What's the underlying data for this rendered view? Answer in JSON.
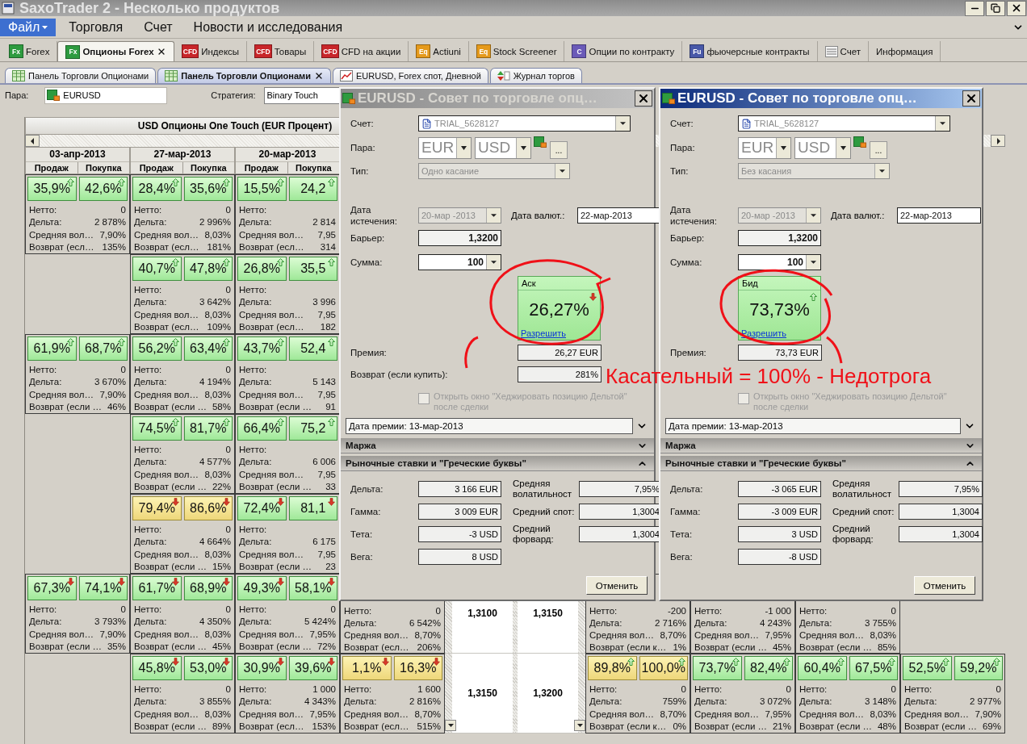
{
  "window": {
    "title": "SaxoTrader 2 - Несколько продуктов"
  },
  "menu": [
    {
      "label": "Файл",
      "selected": true
    },
    {
      "label": "Торговля",
      "selected": false
    },
    {
      "label": "Счет",
      "selected": false
    },
    {
      "label": "Новости и исследования",
      "selected": false
    }
  ],
  "product_tabs": [
    {
      "label": "Forex",
      "kind": "badge",
      "badge": "Fx",
      "color": "#2e9b3f",
      "selected": false
    },
    {
      "label": "Опционы Forex",
      "kind": "badge",
      "badge": "Fx",
      "color": "#2e9b3f",
      "selected": true
    },
    {
      "label": "Индексы",
      "kind": "badge",
      "badge": "CFD",
      "color": "#c8262a",
      "selected": false
    },
    {
      "label": "Товары",
      "kind": "badge",
      "badge": "CFD",
      "color": "#c8262a",
      "selected": false
    },
    {
      "label": "CFD на акции",
      "kind": "badge",
      "badge": "CFD",
      "color": "#c8262a",
      "selected": false
    },
    {
      "label": "Actiuni",
      "kind": "badge",
      "badge": "Eq",
      "color": "#e59a1c",
      "selected": false
    },
    {
      "label": "Stock Screener",
      "kind": "badge",
      "badge": "Eq",
      "color": "#e59a1c",
      "selected": false
    },
    {
      "label": "Опции по контракту",
      "kind": "badge",
      "badge": "C",
      "color": "#6a5ab8",
      "selected": false
    },
    {
      "label": "фьючерсные контракты",
      "kind": "badge",
      "badge": "Fu",
      "color": "#4858a8",
      "selected": false
    },
    {
      "label": "Счет",
      "kind": "sheet",
      "selected": false
    },
    {
      "label": "Информация",
      "kind": "plain",
      "selected": false
    }
  ],
  "panel_tabs": [
    {
      "label": "Панель Торговли Опционами",
      "kind": "panel",
      "selected": false
    },
    {
      "label": "Панель Торговли Опционами",
      "kind": "panel",
      "selected": true
    },
    {
      "label": "EURUSD, Forex спот, Дневной",
      "kind": "chart",
      "selected": false
    },
    {
      "label": "Журнал торгов",
      "kind": "journal",
      "selected": false
    }
  ],
  "filters": {
    "pair_label": "Пара:",
    "pair": "EURUSD",
    "strategy_label": "Стратегия:",
    "strategy": "Binary Touch"
  },
  "grid": {
    "title": "USD Опционы One Touch (EUR Процент)",
    "dates": [
      {
        "date": "03-апр-2013",
        "sell": "Продаж",
        "buy": "Покупка"
      },
      {
        "date": "27-мар-2013",
        "sell": "Продаж",
        "buy": "Покупка"
      },
      {
        "date": "20-мар-2013",
        "sell": "Продаж",
        "buy": "Покупка"
      }
    ],
    "rows": [
      {
        "cells": [
          {
            "kind": "quote",
            "sell": "35,9%",
            "buy": "42,6%",
            "rising": true,
            "highlighted": false,
            "stats": [
              [
                "Нетто:",
                "0"
              ],
              [
                "Дельта:",
                "2 878%"
              ],
              [
                "Средняя вол…",
                "7,90%"
              ],
              [
                "Возврат (есл…",
                "135%"
              ]
            ]
          },
          {
            "kind": "quote",
            "sell": "28,4%",
            "buy": "35,6%",
            "rising": true,
            "highlighted": false,
            "stats": [
              [
                "Нетто:",
                "0"
              ],
              [
                "Дельта:",
                "2 996%"
              ],
              [
                "Средняя вол…",
                "8,03%"
              ],
              [
                "Возврат (есл…",
                "181%"
              ]
            ]
          },
          {
            "kind": "quote",
            "sell": "15,5%",
            "buy": "24,2",
            "rising": true,
            "highlighted": false,
            "stats": [
              [
                "Нетто:"
              ],
              [
                "Дельта:",
                "2 814"
              ],
              [
                "Средняя вол…",
                "7,95"
              ],
              [
                "Возврат (есл…",
                "314"
              ]
            ]
          },
          {
            "kind": "blank"
          },
          {
            "kind": "blank"
          },
          {
            "kind": "blank"
          },
          {
            "kind": "blank"
          },
          {
            "kind": "blank"
          },
          {
            "kind": "blank"
          },
          {
            "kind": "blank"
          }
        ]
      },
      {
        "cells": [
          {
            "kind": "blank"
          },
          {
            "kind": "quote",
            "sell": "40,7%",
            "buy": "47,8%",
            "rising": true,
            "highlighted": false,
            "stats": [
              [
                "Нетто:",
                "0"
              ],
              [
                "Дельта:",
                "3 642%"
              ],
              [
                "Средняя вол…",
                "8,03%"
              ],
              [
                "Возврат (есл…",
                "109%"
              ]
            ]
          },
          {
            "kind": "quote",
            "sell": "26,8%",
            "buy": "35,5",
            "rising": true,
            "highlighted": false,
            "stats": [
              [
                "Нетто:"
              ],
              [
                "Дельта:",
                "3 996"
              ],
              [
                "Средняя вол…",
                "7,95"
              ],
              [
                "Возврат (есл…",
                "182"
              ]
            ]
          },
          {
            "kind": "blank"
          },
          {
            "kind": "blank"
          },
          {
            "kind": "blank"
          },
          {
            "kind": "blank"
          },
          {
            "kind": "blank"
          },
          {
            "kind": "blank"
          },
          {
            "kind": "blank"
          }
        ]
      },
      {
        "cells": [
          {
            "kind": "quote",
            "sell": "61,9%",
            "buy": "68,7%",
            "rising": true,
            "highlighted": false,
            "stats": [
              [
                "Нетто:",
                "0"
              ],
              [
                "Дельта:",
                "3 670%"
              ],
              [
                "Средняя вол…",
                "7,90%"
              ],
              [
                "Возврат (если …",
                "46%"
              ]
            ]
          },
          {
            "kind": "quote",
            "sell": "56,2%",
            "buy": "63,4%",
            "rising": true,
            "highlighted": false,
            "stats": [
              [
                "Нетто:",
                "0"
              ],
              [
                "Дельта:",
                "4 194%"
              ],
              [
                "Средняя вол…",
                "8,03%"
              ],
              [
                "Возврат (если …",
                "58%"
              ]
            ]
          },
          {
            "kind": "quote",
            "sell": "43,7%",
            "buy": "52,4",
            "rising": true,
            "highlighted": false,
            "stats": [
              [
                "Нетто:"
              ],
              [
                "Дельта:",
                "5 143"
              ],
              [
                "Средняя вол…",
                "7,95"
              ],
              [
                "Возврат (если …",
                "91"
              ]
            ]
          },
          {
            "kind": "blank"
          },
          {
            "kind": "blank"
          },
          {
            "kind": "blank"
          },
          {
            "kind": "blank"
          },
          {
            "kind": "blank"
          },
          {
            "kind": "blank"
          },
          {
            "kind": "blank"
          }
        ]
      },
      {
        "cells": [
          {
            "kind": "blank"
          },
          {
            "kind": "quote",
            "sell": "74,5%",
            "buy": "81,7%",
            "rising": true,
            "highlighted": false,
            "stats": [
              [
                "Нетто:",
                "0"
              ],
              [
                "Дельта:",
                "4 577%"
              ],
              [
                "Средняя вол…",
                "8,03%"
              ],
              [
                "Возврат (если …",
                "22%"
              ]
            ]
          },
          {
            "kind": "quote",
            "sell": "66,4%",
            "buy": "75,2",
            "rising": true,
            "highlighted": false,
            "stats": [
              [
                "Нетто:"
              ],
              [
                "Дельта:",
                "6 006"
              ],
              [
                "Средняя вол…",
                "7,95"
              ],
              [
                "Возврат (если …",
                "33"
              ]
            ]
          },
          {
            "kind": "blank"
          },
          {
            "kind": "blank"
          },
          {
            "kind": "blank"
          },
          {
            "kind": "blank"
          },
          {
            "kind": "blank"
          },
          {
            "kind": "blank"
          },
          {
            "kind": "blank"
          }
        ]
      },
      {
        "cells": [
          {
            "kind": "blank"
          },
          {
            "kind": "quote",
            "sell": "79,4%",
            "buy": "86,6%",
            "rising": false,
            "highlighted": true,
            "stats": [
              [
                "Нетто:",
                "0"
              ],
              [
                "Дельта:",
                "4 664%"
              ],
              [
                "Средняя вол…",
                "8,03%"
              ],
              [
                "Возврат (если …",
                "15%"
              ]
            ]
          },
          {
            "kind": "quote",
            "sell": "72,4%",
            "buy": "81,1",
            "rising": false,
            "highlighted": false,
            "stats": [
              [
                "Нетто:"
              ],
              [
                "Дельта:",
                "6 175"
              ],
              [
                "Средняя вол…",
                "7,95"
              ],
              [
                "Возврат (если …",
                "23"
              ]
            ]
          },
          {
            "kind": "blank"
          },
          {
            "kind": "blank"
          },
          {
            "kind": "blank"
          },
          {
            "kind": "blank"
          },
          {
            "kind": "blank"
          },
          {
            "kind": "blank"
          },
          {
            "kind": "blank"
          }
        ]
      },
      {
        "cells": [
          {
            "kind": "quote",
            "sell": "67,3%",
            "buy": "74,1%",
            "rising": false,
            "highlighted": false,
            "stats": [
              [
                "Нетто:",
                "0"
              ],
              [
                "Дельта:",
                "3 793%"
              ],
              [
                "Средняя вол…",
                "7,90%"
              ],
              [
                "Возврат (если …",
                "35%"
              ]
            ]
          },
          {
            "kind": "quote",
            "sell": "61,7%",
            "buy": "68,9%",
            "rising": false,
            "highlighted": false,
            "stats": [
              [
                "Нетто:",
                "0"
              ],
              [
                "Дельта:",
                "4 350%"
              ],
              [
                "Средняя вол…",
                "8,03%"
              ],
              [
                "Возврат (если …",
                "45%"
              ]
            ]
          },
          {
            "kind": "quote",
            "sell": "49,3%",
            "buy": "58,1%",
            "rising": false,
            "highlighted": false,
            "stats": [
              [
                "Нетто:",
                "0"
              ],
              [
                "Дельта:",
                "5 424%"
              ],
              [
                "Средняя вол…",
                "7,95%"
              ],
              [
                "Возврат (если …",
                "72%"
              ]
            ]
          },
          {
            "kind": "stats",
            "stats": [
              [
                "Нетто:",
                "0"
              ],
              [
                "Дельта:",
                "6 542%"
              ],
              [
                "Средняя вол…",
                "8,70%"
              ],
              [
                "Возврат (есл…",
                "206%"
              ]
            ]
          },
          {
            "kind": "strike",
            "value": "1,3100"
          },
          {
            "kind": "strike",
            "value": "1,3150"
          },
          {
            "kind": "stats",
            "stats": [
              [
                "Нетто:",
                "-200"
              ],
              [
                "Дельта:",
                "2 716%"
              ],
              [
                "Средняя вол…",
                "8,70%"
              ],
              [
                "Возврат (если к…",
                "1%"
              ]
            ]
          },
          {
            "kind": "stats",
            "stats": [
              [
                "Нетто:",
                "-1 000"
              ],
              [
                "Дельта:",
                "4 243%"
              ],
              [
                "Средняя вол…",
                "7,95%"
              ],
              [
                "Возврат (если …",
                "45%"
              ]
            ]
          },
          {
            "kind": "stats",
            "stats": [
              [
                "Нетто:",
                "0"
              ],
              [
                "Дельта:",
                "3 755%"
              ],
              [
                "Средняя вол…",
                "8,03%"
              ],
              [
                "Возврат (если …",
                "85%"
              ]
            ]
          },
          {
            "kind": "blank"
          }
        ]
      },
      {
        "cells": [
          {
            "kind": "blank"
          },
          {
            "kind": "quote",
            "sell": "45,8%",
            "buy": "53,0%",
            "rising": false,
            "highlighted": false,
            "stats": [
              [
                "Нетто:",
                "0"
              ],
              [
                "Дельта:",
                "3 855%"
              ],
              [
                "Средняя вол…",
                "8,03%"
              ],
              [
                "Возврат (если …",
                "89%"
              ]
            ]
          },
          {
            "kind": "quote",
            "sell": "30,9%",
            "buy": "39,6%",
            "rising": false,
            "highlighted": false,
            "stats": [
              [
                "Нетто:",
                "1 000"
              ],
              [
                "Дельта:",
                "4 343%"
              ],
              [
                "Средняя вол…",
                "7,95%"
              ],
              [
                "Возврат (есл…",
                "153%"
              ]
            ]
          },
          {
            "kind": "quote",
            "sell": "1,1%",
            "buy": "16,3%",
            "rising": false,
            "highlighted": true,
            "stats": [
              [
                "Нетто:",
                "1 600"
              ],
              [
                "Дельта:",
                "2 816%"
              ],
              [
                "Средняя вол…",
                "8,70%"
              ],
              [
                "Возврат (есл…",
                "515%"
              ]
            ]
          },
          {
            "kind": "strike",
            "value": "1,3150"
          },
          {
            "kind": "strike",
            "value": "1,3200"
          },
          {
            "kind": "quote",
            "sell": "89,8%",
            "buy": "100,0%",
            "rising": true,
            "highlighted": true,
            "stats": [
              [
                "Нетто:",
                "0"
              ],
              [
                "Дельта:",
                "759%"
              ],
              [
                "Средняя вол…",
                "8,70%"
              ],
              [
                "Возврат (если к…",
                "0%"
              ]
            ]
          },
          {
            "kind": "quote",
            "sell": "73,7%",
            "buy": "82,4%",
            "rising": true,
            "highlighted": false,
            "stats": [
              [
                "Нетто:",
                "0"
              ],
              [
                "Дельта:",
                "3 072%"
              ],
              [
                "Средняя вол…",
                "7,95%"
              ],
              [
                "Возврат (если …",
                "21%"
              ]
            ]
          },
          {
            "kind": "quote",
            "sell": "60,4%",
            "buy": "67,5%",
            "rising": true,
            "highlighted": false,
            "stats": [
              [
                "Нетто:",
                "0"
              ],
              [
                "Дельта:",
                "3 148%"
              ],
              [
                "Средняя вол…",
                "8,03%"
              ],
              [
                "Возврат (если …",
                "48%"
              ]
            ]
          },
          {
            "kind": "quote",
            "sell": "52,5%",
            "buy": "59,2%",
            "rising": true,
            "highlighted": false,
            "stats": [
              [
                "Нетто:",
                "0"
              ],
              [
                "Дельта:",
                "2 977%"
              ],
              [
                "Средняя вол…",
                "7,90%"
              ],
              [
                "Возврат (если …",
                "69%"
              ]
            ]
          }
        ]
      }
    ]
  },
  "dialogs": [
    {
      "title": "EURUSD - Совет по торговле опц…",
      "active": false,
      "account": {
        "label": "Счет:",
        "value": "TRIAL_5628127"
      },
      "pair": {
        "label": "Пара:",
        "base": "EUR",
        "quote": "USD",
        "more": "..."
      },
      "type": {
        "label": "Тип:",
        "value": "Одно касание",
        "disabled": true
      },
      "expiry": {
        "label": "Дата истечения:",
        "value": "20-мар -2013",
        "disabled": true
      },
      "value_date": {
        "label": "Дата валют.:",
        "value": "22-мар-2013"
      },
      "barrier": {
        "label": "Барьер:",
        "value": "1,3200"
      },
      "amount": {
        "label": "Сумма:",
        "value": "100"
      },
      "quote": {
        "ask": true,
        "label": "Аск",
        "value": "26,27%",
        "rising": false,
        "link": "Разрешить"
      },
      "fields": [
        {
          "label": "Премия:",
          "value": "26,27 EUR"
        },
        {
          "label": "Возврат (если купить):",
          "value": "281%"
        }
      ],
      "hedge": {
        "label": "Открыть окно \"Хеджировать позицию Дельтой\" после сделки",
        "checked": false,
        "disabled": true
      },
      "premium_date": "Дата премии: 13-мар-2013",
      "sections": [
        {
          "title": "Маржа",
          "expanded": false
        },
        {
          "title": "Рыночные ставки и \"Греческие буквы\"",
          "expanded": true
        }
      ],
      "greeks": [
        {
          "label": "Дельта:",
          "value": "3 166 EUR"
        },
        {
          "label": "Гамма:",
          "value": "3 009 EUR"
        },
        {
          "label": "Тета:",
          "value": "-3 USD"
        },
        {
          "label": "Вега:",
          "value": "8 USD"
        }
      ],
      "averages": [
        {
          "label": "Средняя волатильност",
          "value": "7,95%"
        },
        {
          "label": "Средний спот:",
          "value": "1,3004"
        },
        {
          "label": "Средний форвард:",
          "value": "1,3004"
        }
      ],
      "cancel": "Отменить"
    },
    {
      "title": "EURUSD - Совет по торговле опц…",
      "active": true,
      "account": {
        "label": "Счет:",
        "value": "TRIAL_5628127"
      },
      "pair": {
        "label": "Пара:",
        "base": "EUR",
        "quote": "USD",
        "more": "..."
      },
      "type": {
        "label": "Тип:",
        "value": "Без касания",
        "disabled": true
      },
      "expiry": {
        "label": "Дата истечения:",
        "value": "20-мар -2013",
        "disabled": true
      },
      "value_date": {
        "label": "Дата валют.:",
        "value": "22-мар-2013"
      },
      "barrier": {
        "label": "Барьер:",
        "value": "1,3200"
      },
      "amount": {
        "label": "Сумма:",
        "value": "100"
      },
      "quote": {
        "ask": false,
        "label": "Бид",
        "value": "73,73%",
        "rising": true,
        "link": "Разрешить"
      },
      "fields": [
        {
          "label": "Премия:",
          "value": "73,73 EUR"
        }
      ],
      "hedge": {
        "label": "Открыть окно \"Хеджировать позицию Дельтой\" после сделки",
        "checked": false,
        "disabled": true
      },
      "premium_date": "Дата премии: 13-мар-2013",
      "sections": [
        {
          "title": "Маржа",
          "expanded": false
        },
        {
          "title": "Рыночные ставки и \"Греческие буквы\"",
          "expanded": true
        }
      ],
      "greeks": [
        {
          "label": "Дельта:",
          "value": "-3 065 EUR"
        },
        {
          "label": "Гамма:",
          "value": "-3 009 EUR"
        },
        {
          "label": "Тета:",
          "value": "3 USD"
        },
        {
          "label": "Вега:",
          "value": "-8 USD"
        }
      ],
      "averages": [
        {
          "label": "Средняя волатильност",
          "value": "7,95%"
        },
        {
          "label": "Средний спот:",
          "value": "1,3004"
        },
        {
          "label": "Средний форвард:",
          "value": "1,3004"
        }
      ],
      "cancel": "Отменить"
    }
  ],
  "annotation": {
    "text": "Касательный = 100% - Недотрога"
  }
}
